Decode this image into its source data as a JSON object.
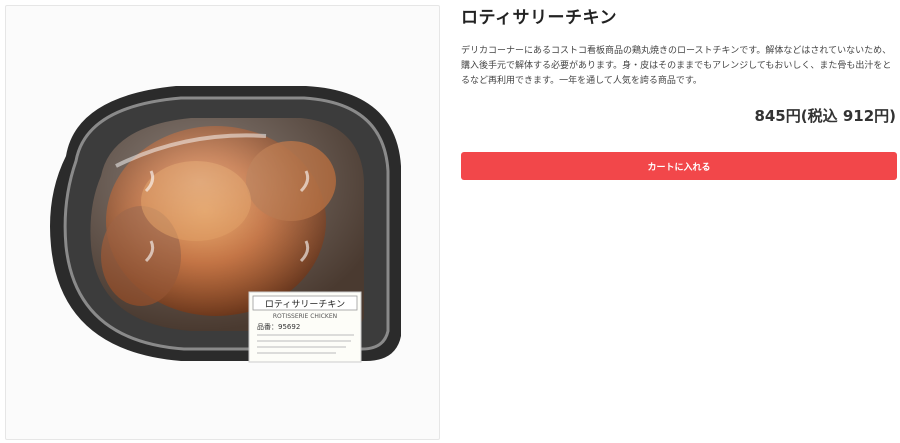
{
  "product": {
    "title": "ロティサリーチキン",
    "description": "デリカコーナーにあるコストコ看板商品の鶏丸焼きのローストチキンです。解体などはされていないため、購入後手元で解体する必要があります。身・皮はそのままでもアレンジしてもおいしく、また骨も出汁をとるなど再利用できます。一年を通して人気を誇る商品です。",
    "price": "845円(税込 912円)",
    "cart_button_label": "カートに入れる"
  },
  "image": {
    "subject": "rotisserie-chicken-in-container",
    "label_title": "ロティサリーチキン",
    "label_subtitle": "ROTISSERIE CHICKEN",
    "label_item_no": "品番：95692"
  },
  "colors": {
    "accent": "#f2474a",
    "title": "#222222",
    "text": "#444444"
  }
}
